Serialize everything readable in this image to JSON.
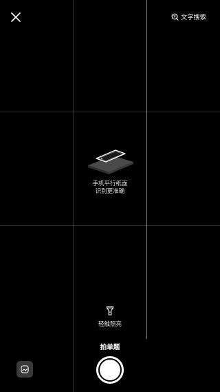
{
  "top_bar": {
    "close_icon": "close-icon",
    "text_search_icon": "text-search-icon",
    "text_search_label": "文字搜索"
  },
  "center_hint": {
    "illustration_icon": "phone-parallel-icon",
    "line1": "手机平行纸面",
    "line2": "识别更准确"
  },
  "flashlight": {
    "icon": "flashlight-icon",
    "label": "轻触照亮"
  },
  "bottom_bar": {
    "mode_label": "拍单题",
    "gallery_icon": "gallery-icon",
    "shutter_icon": "shutter-icon"
  },
  "colors": {
    "background": "#000000",
    "foreground": "#ffffff",
    "grid_line": "rgba(255,255,255,0.18)",
    "gallery_bg": "#3a3a3a"
  }
}
